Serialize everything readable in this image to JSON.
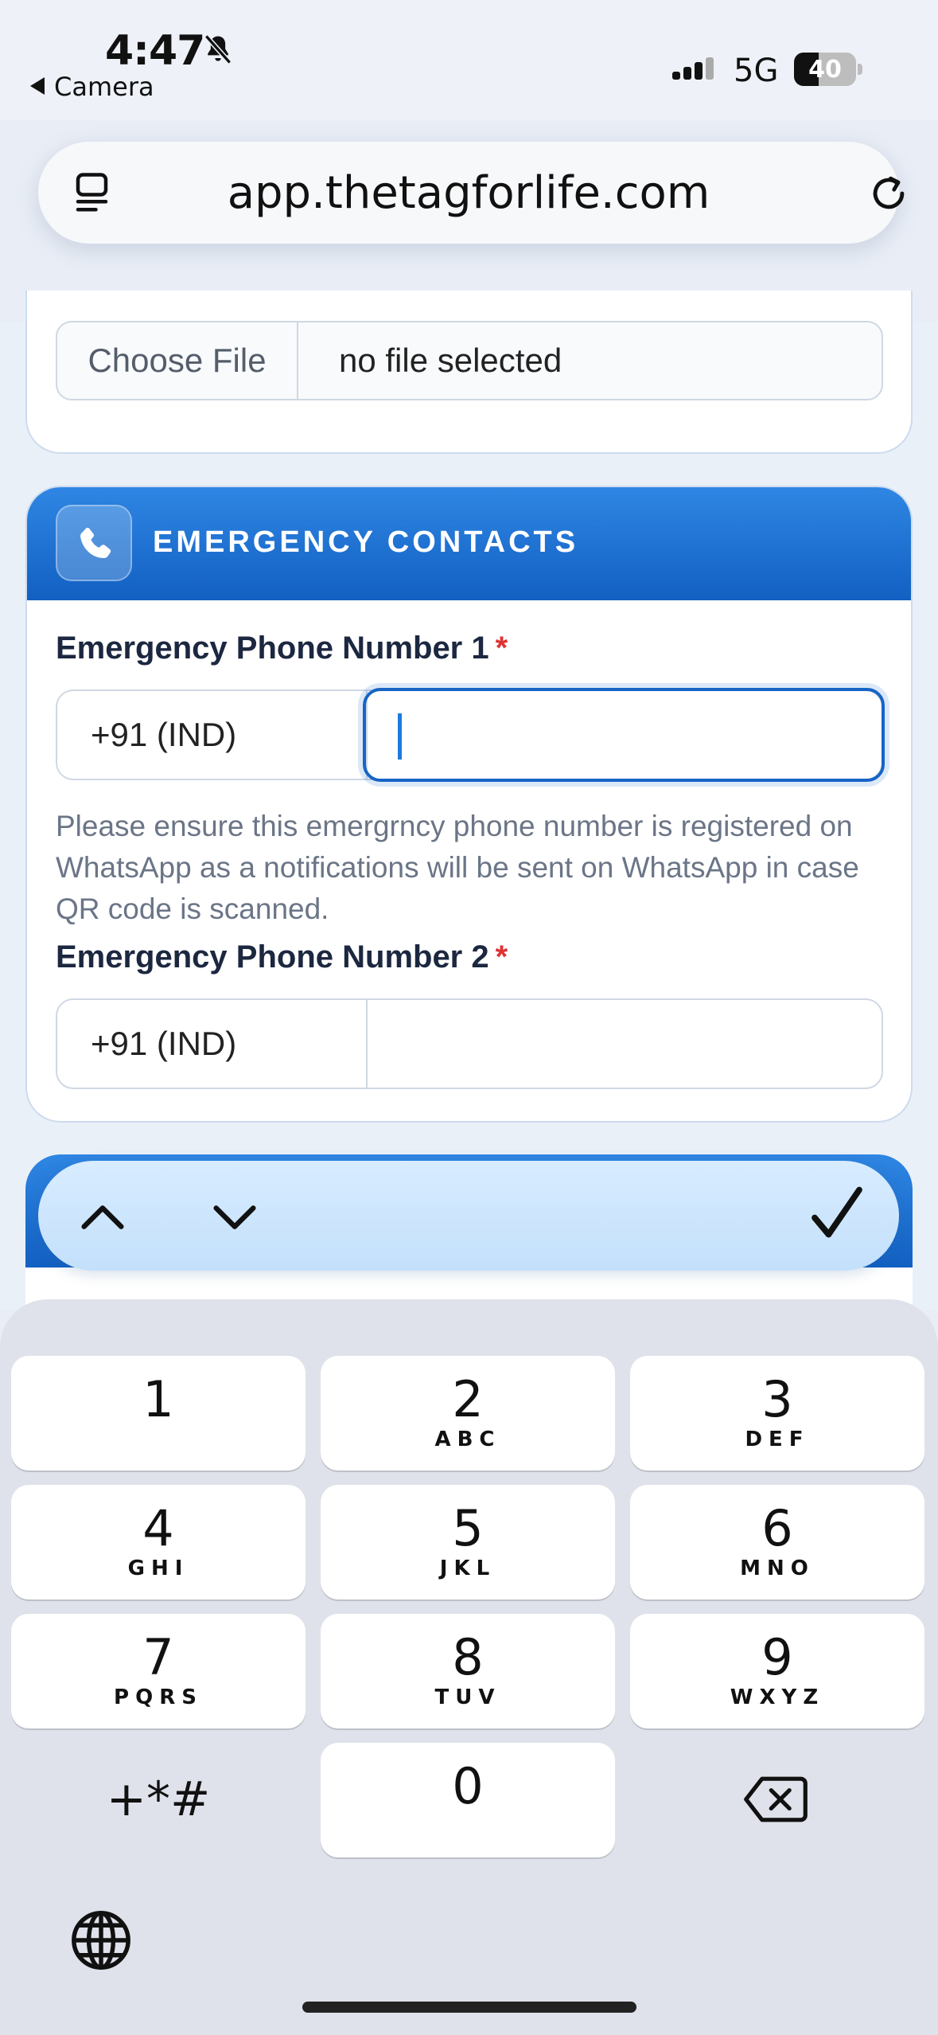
{
  "status_bar": {
    "time": "4:47",
    "back_label": "Camera",
    "network": "5G",
    "battery": "40"
  },
  "browser": {
    "url": "app.thetagforlife.com"
  },
  "upload_card": {
    "choose_file_label": "Choose File",
    "file_status": "no file selected"
  },
  "emergency": {
    "section_title": "EMERGENCY CONTACTS",
    "phone1_label": "Emergency Phone Number 1",
    "phone1_country": "+91 (IND)",
    "phone1_value": "",
    "hint": "Please ensure this emergrncy phone number is registered on WhatsApp as a notifications will be sent on WhatsApp in case QR code is scanned.",
    "phone2_label": "Emergency Phone Number 2",
    "phone2_country": "+91 (IND)",
    "phone2_value": "",
    "required_mark": "*"
  },
  "keyboard": {
    "keys": [
      {
        "digit": "1",
        "letters": ""
      },
      {
        "digit": "2",
        "letters": "ABC"
      },
      {
        "digit": "3",
        "letters": "DEF"
      },
      {
        "digit": "4",
        "letters": "GHI"
      },
      {
        "digit": "5",
        "letters": "JKL"
      },
      {
        "digit": "6",
        "letters": "MNO"
      },
      {
        "digit": "7",
        "letters": "PQRS"
      },
      {
        "digit": "8",
        "letters": "TUV"
      },
      {
        "digit": "9",
        "letters": "WXYZ"
      },
      {
        "digit": "0",
        "letters": ""
      }
    ],
    "symbols_label": "+*#"
  },
  "icons": {
    "bell": "bell-slash-icon",
    "tabs": "tabs-icon",
    "reload": "reload-icon",
    "phone": "phone-icon",
    "up": "chevron-up-icon",
    "down": "chevron-down-icon",
    "done": "checkmark-icon",
    "backspace": "backspace-icon",
    "globe": "globe-icon"
  },
  "colors": {
    "accent": "#1664c6",
    "header_gradient_top": "#2f86e3",
    "header_gradient_bottom": "#1260c2",
    "required": "#dd3333"
  }
}
